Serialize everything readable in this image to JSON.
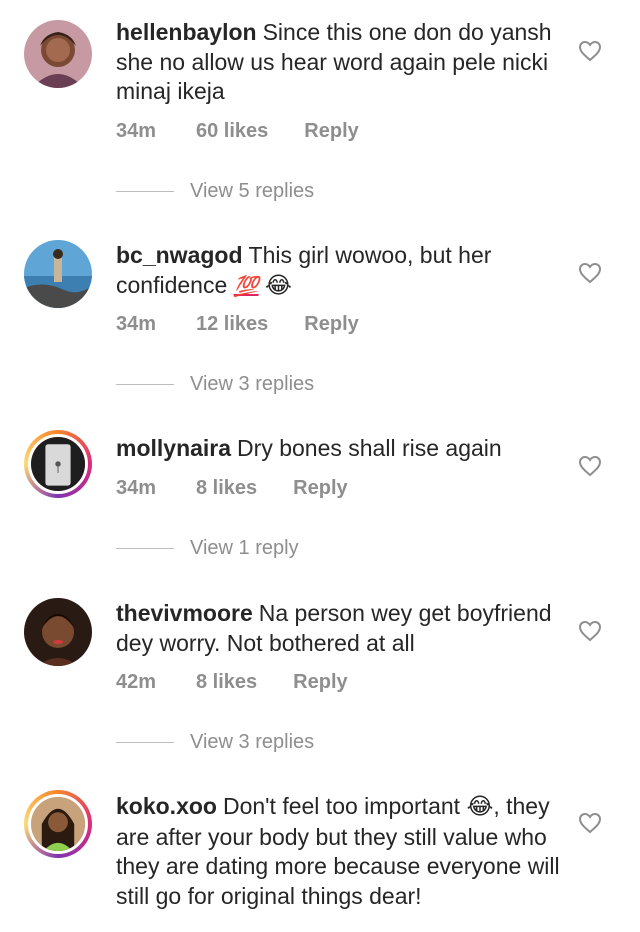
{
  "comments": [
    {
      "username": "hellenbaylon",
      "text": "Since this one don do yansh she no allow us hear word again pele nicki minaj ikeja",
      "time": "34m",
      "likes": "60 likes",
      "reply": "Reply",
      "view_replies": "View 5 replies"
    },
    {
      "username": "bc_nwagod",
      "text": "This girl wowoo, but her confidence",
      "emoji_hundred": "💯",
      "emoji_laugh": "😂",
      "time": "34m",
      "likes": "12 likes",
      "reply": "Reply",
      "view_replies": "View 3 replies"
    },
    {
      "username": "mollynaira",
      "text": "Dry bones shall rise again",
      "time": "34m",
      "likes": "8 likes",
      "reply": "Reply",
      "view_replies": "View 1 reply"
    },
    {
      "username": "thevivmoore",
      "text": "Na person wey get boyfriend dey worry. Not bothered at all",
      "time": "42m",
      "likes": "8 likes",
      "reply": "Reply",
      "view_replies": "View 3 replies"
    },
    {
      "username": "koko.xoo",
      "text_before": "Don't feel too important",
      "emoji_laugh": "😂",
      "text_after": ", they are after your body but they still value who they are dating more because everyone will still go for original things dear!"
    }
  ],
  "icons": {
    "like": "heart-outline-icon"
  },
  "colors": {
    "text": "#262626",
    "secondary": "#8e8e8e",
    "story_ring": "#dd2a7b"
  }
}
